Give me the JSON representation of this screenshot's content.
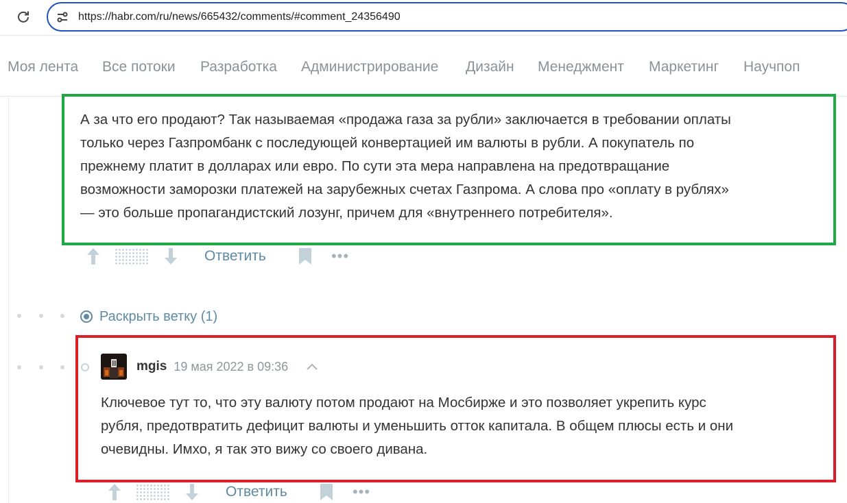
{
  "browser": {
    "url": "https://habr.com/ru/news/665432/comments/#comment_24356490"
  },
  "nav": {
    "items": [
      "Моя лента",
      "Все потоки",
      "Разработка",
      "Администрирование",
      "Дизайн",
      "Менеджмент",
      "Маркетинг",
      "Научпоп"
    ]
  },
  "comment1": {
    "lines": [
      "А за что его продают? Так называемая «продажа газа за рубли» заключается в требовании оплаты",
      "только через Газпромбанк с последующей конвертацией им валюты в рубли. А покупатель по",
      "прежнему платит в долларах или евро. По сути эта мера направлена на предотвращание",
      "возможности заморозки платежей на зарубежных счетах Газпрома. А слова про «оплату в рублях»",
      "— это больше пропагандистский лозунг, причем для «внутреннего потребителя»."
    ],
    "reply_label": "Ответить"
  },
  "expand_thread": {
    "label": "Раскрыть ветку (1)"
  },
  "comment2": {
    "username": "mgis",
    "date": "19 мая 2022 в 09:36",
    "lines": [
      "Ключевое тут то, что эту валюту потом продают на Мосбирже и это позволяет укрепить курс",
      "рубля, предотвратить дефицит валюты и уменьшить отток капитала. В общем плюсы есть и они",
      "очевидны. Имхо, я так это вижу со своего дивана."
    ],
    "reply_label": "Ответить"
  },
  "icons": {
    "reload": "reload-icon",
    "site_info": "site-info-icon",
    "vote_up": "arrow-up-icon",
    "vote_down": "arrow-down-icon",
    "bookmark": "bookmark-icon",
    "more": "more-icon",
    "expand": "target-icon",
    "collapse": "chevron-up-icon"
  },
  "colors": {
    "url_border": "#1f53b8",
    "highlight_green": "#1fa844",
    "highlight_red": "#dc1e2a",
    "link": "#5e8aa3"
  }
}
